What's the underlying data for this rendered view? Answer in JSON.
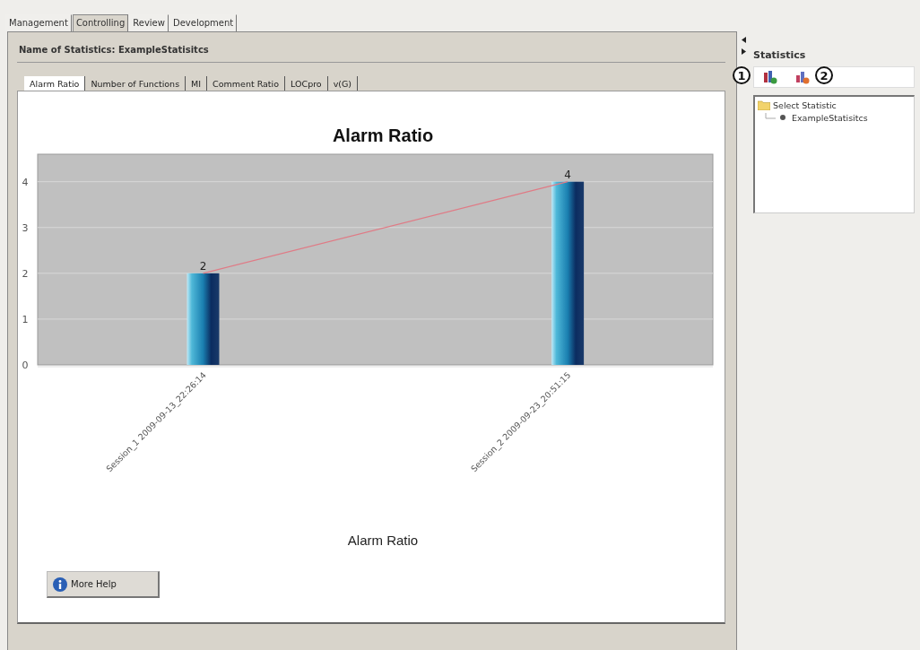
{
  "top_tabs": [
    {
      "label": "Management",
      "selected": false
    },
    {
      "label": "Controlling",
      "selected": true
    },
    {
      "label": "Review",
      "selected": false
    },
    {
      "label": "Development",
      "selected": false
    }
  ],
  "header": "Name of Statistics: ExampleStatisitcs",
  "chart_tabs": [
    {
      "label": "Alarm Ratio",
      "selected": true
    },
    {
      "label": "Number of Functions",
      "selected": false
    },
    {
      "label": "MI",
      "selected": false
    },
    {
      "label": "Comment Ratio",
      "selected": false
    },
    {
      "label": "LOCpro",
      "selected": false
    },
    {
      "label": "v(G)",
      "selected": false
    }
  ],
  "chart_data": {
    "type": "bar",
    "title": "Alarm Ratio",
    "xlabel": "Alarm Ratio",
    "categories": [
      "Session_1 2009-09-13_22:26:14",
      "Session_2 2009-09-23_20:51:15"
    ],
    "values": [
      2,
      4
    ],
    "ylim": [
      0,
      4.6
    ],
    "yticks": [
      0,
      1,
      2,
      3,
      4
    ],
    "data_labels": true,
    "grid": true
  },
  "help_button": "More Help",
  "side_panel": {
    "title": "Statistics",
    "callouts": [
      "1",
      "2"
    ],
    "tree": {
      "label": "Select Statistic",
      "expanded": true,
      "children": [
        {
          "label": "ExampleStatisitcs"
        }
      ]
    }
  }
}
